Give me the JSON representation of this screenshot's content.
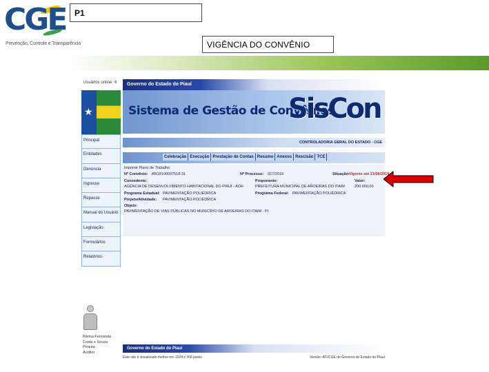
{
  "logo": {
    "word": "CGE",
    "tagline": "Prevenção, Controle e Transparência"
  },
  "slide": {
    "label": "P1",
    "title": "VIGÊNCIA DO CONVÊNIO"
  },
  "colors": {
    "navy": "#0d2a74",
    "highlight_red": "#d02020",
    "arrow_red": "#e00000",
    "band_green": "#5a9a2a"
  },
  "screen": {
    "online": "Usuários online: 4",
    "gov_label": "Governo do Estado do Piauí",
    "banner_title": "Sistema de Gestão de Convênios",
    "siscon": "SisCon",
    "topline": "CONTROLADORIA GERAL DO ESTADO - CGE",
    "sidebar": [
      "Principal",
      "Entidades",
      "Denúncia",
      "Ingresso",
      "Repasse",
      "Manual do Usuário",
      "Legislação",
      "Formulários",
      "Relatórios"
    ],
    "tabs": [
      "Celebração",
      "Execução",
      "Prestação de Contas",
      "Resumo",
      "Anexos",
      "Rescisão",
      "TCE"
    ],
    "details": {
      "print_link": "Imprimir Plano de Trabalho",
      "convenio_label": "Nº Convênio:",
      "convenio_value": "AN18100097518-31",
      "processo_label": "Nº Processo:",
      "processo_value": "027/2018",
      "situacao_label": "Situação:",
      "situacao_value": "Vigente até 21/06/2019",
      "concedente_label": "Concedente:",
      "concedente_value": "AGÊNCIA DE DESENVOLVIMENTO HABITACIONAL DO PIAUÍ - ADH",
      "proponente_label": "Proponente:",
      "proponente_value": "PREFEITURA MUNICIPAL DE AROEIRAS DO ITAIM",
      "valor_label": "Valor:",
      "valor_value": "200.000,00",
      "prog_estadual_label": "Programa Estadual:",
      "prog_estadual_value": "PAVIMENTAÇÃO POLIÉDRICA",
      "prog_federal_label": "Programa Federal:",
      "prog_federal_value": "PAVIMENTAÇÃO POLIÉDRICA",
      "projeto_label": "Projeto/Atividade:",
      "projeto_value": "PAVIMENTAÇÃO POLIÉDRICA",
      "objeto_label": "Objeto:",
      "objeto_value": "PAVIMENTAÇÃO DE VIAS PÚBLICAS NO MUNICÍPIO DE AROEIRAS DO ITAIM - PI"
    },
    "user": [
      "Kárina Fernanda",
      "Costa e Souza",
      "Pereira",
      "Auditor"
    ],
    "footer_gov": "Governo do Estado do Piauí",
    "footer_left": "Este site é visualizado melhor em 1024 x 768 pixels",
    "footer_right": "Versão: ATI/CGE do Governo do Estado do Piauí"
  }
}
